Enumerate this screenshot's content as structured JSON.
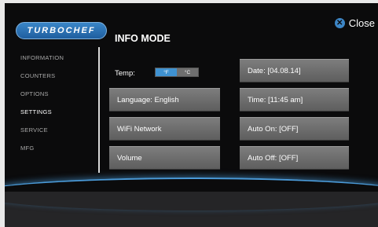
{
  "brand": {
    "logo_text": "TURBOCHEF"
  },
  "header": {
    "title": "INFO MODE",
    "close_label": "Close"
  },
  "sidebar": {
    "items": [
      {
        "label": "INFORMATION",
        "active": false
      },
      {
        "label": "COUNTERS",
        "active": false
      },
      {
        "label": "OPTIONS",
        "active": false
      },
      {
        "label": "SETTINGS",
        "active": true
      },
      {
        "label": "SERVICE",
        "active": false
      },
      {
        "label": "MFG",
        "active": false
      }
    ]
  },
  "settings": {
    "temp_label": "Temp:",
    "temp_units": {
      "fahrenheit": "°F",
      "celsius": "°C",
      "selected": "fahrenheit"
    },
    "language": "Language: English",
    "wifi": "WiFi Network",
    "volume": "Volume",
    "date": "Date: [04.08.14]",
    "time": "Time: [11:45 am]",
    "auto_on": "Auto On: [OFF]",
    "auto_off": "Auto Off: [OFF]"
  },
  "colors": {
    "accent": "#3f92d1",
    "button": "#6e6e6e",
    "background": "#0b0b0c"
  }
}
